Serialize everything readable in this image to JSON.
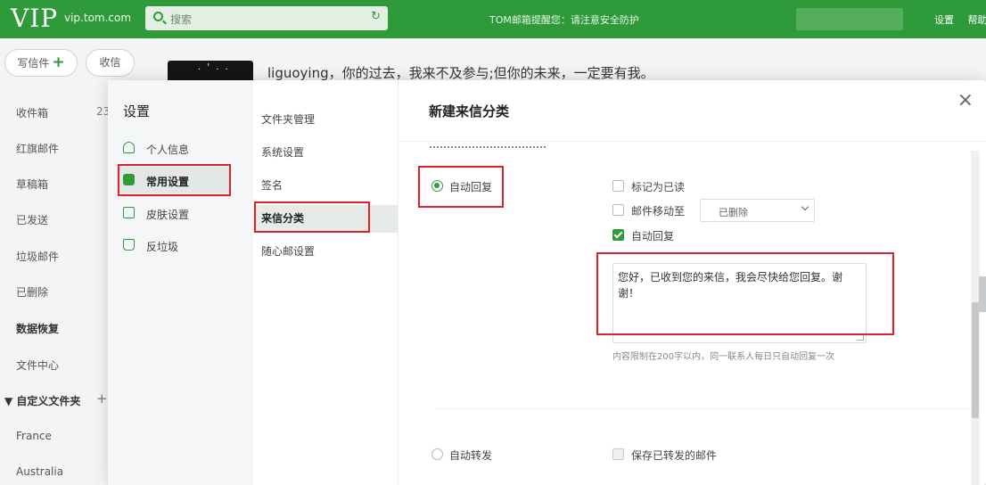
{
  "topbar": {
    "logo": "VIP",
    "domain": "vip.tom.com",
    "search_placeholder": "搜索",
    "notice": "TOM邮箱提醒您：请注意安全防护",
    "links": [
      "设置",
      "帮助"
    ]
  },
  "sidebar": {
    "compose_label": "写信件",
    "receive_label": "收信",
    "folders": [
      {
        "label": "收件箱",
        "count": "23"
      },
      {
        "label": "红旗邮件"
      },
      {
        "label": "草稿箱"
      },
      {
        "label": "已发送"
      },
      {
        "label": "垃圾邮件"
      },
      {
        "label": "已删除"
      },
      {
        "label": "数据恢复",
        "bold": true
      },
      {
        "label": "文件中心"
      }
    ],
    "custom_folder": {
      "label": "自定义文件夹",
      "items": [
        "France",
        "Australia"
      ]
    }
  },
  "content": {
    "promo_text": "liguoying，你的过去，我来不及参与;但你的未来，一定要有我。"
  },
  "dialog": {
    "title": "设置",
    "nav1": [
      {
        "label": "个人信息",
        "icon": "person-icon"
      },
      {
        "label": "常用设置",
        "icon": "tag-icon",
        "active": true
      },
      {
        "label": "皮肤设置",
        "icon": "shirt-icon"
      },
      {
        "label": "反垃圾",
        "icon": "shield-bag-icon"
      }
    ],
    "nav2": [
      {
        "label": "文件夹管理"
      },
      {
        "label": "系统设置"
      },
      {
        "label": "签名"
      },
      {
        "label": "来信分类",
        "active": true
      },
      {
        "label": "随心邮设置"
      }
    ],
    "panel": {
      "title": "新建来信分类",
      "close": "×",
      "action_radio_label": "自动回复",
      "options": {
        "mark_read": "标记为已读",
        "move_to": "邮件移动至",
        "move_target": "已删除",
        "auto_reply": "自动回复"
      },
      "reply_text": "您好，已收到您的来信，我会尽快给您回复。谢谢！",
      "hint": "内容限制在200字以内，同一联系人每日只自动回复一次",
      "bottom": {
        "forward_label": "自动转发",
        "keep_label": "保存已转发的邮件"
      }
    }
  },
  "colors": {
    "brand_green": "#2f9a3a",
    "annotation_red": "#e0202a"
  }
}
